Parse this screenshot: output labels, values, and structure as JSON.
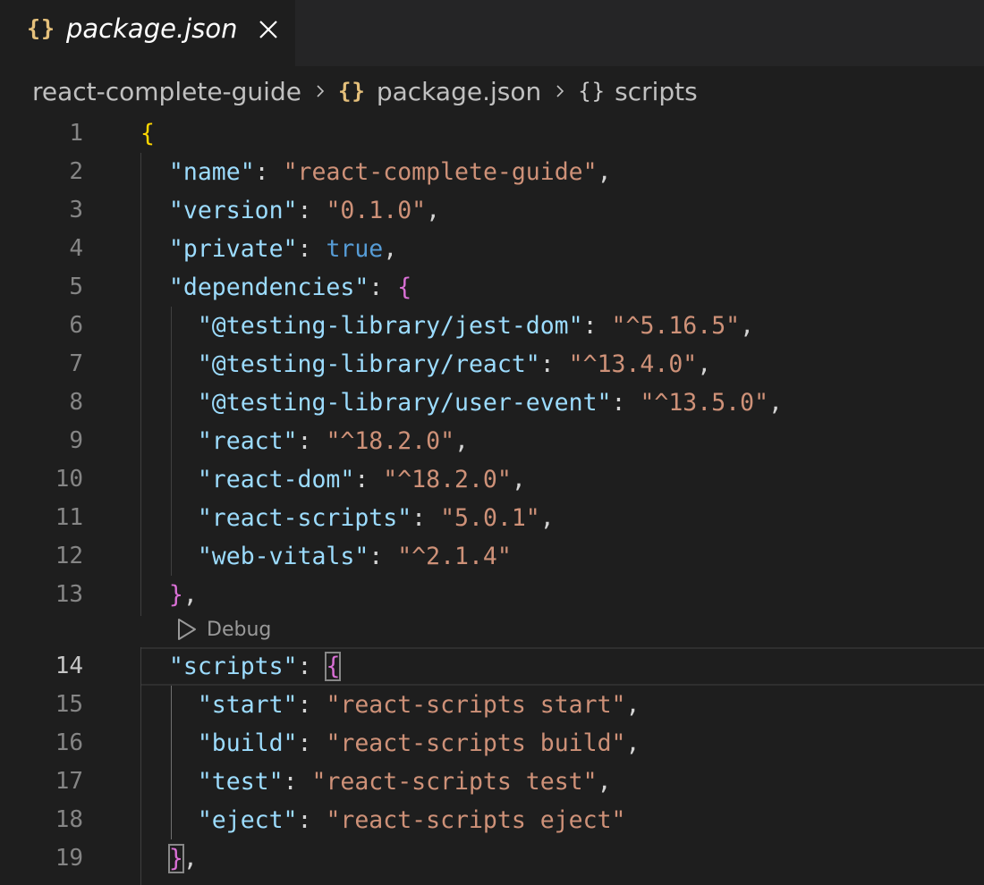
{
  "tab": {
    "icon": "json-braces-icon",
    "label": "package.json",
    "close_icon": "close-icon"
  },
  "breadcrumb": {
    "items": [
      {
        "label": "react-complete-guide"
      },
      {
        "icon": "json-braces-icon",
        "label": "package.json"
      },
      {
        "icon": "object-braces-icon",
        "label": "scripts"
      }
    ]
  },
  "codelens": {
    "icon": "play-outline-icon",
    "label": "Debug"
  },
  "editor": {
    "active_line": 14,
    "lines": [
      {
        "n": "1",
        "tokens": [
          [
            "b1",
            "{"
          ]
        ]
      },
      {
        "n": "2",
        "tokens": [
          [
            "i",
            "  "
          ],
          [
            "key",
            "\"name\""
          ],
          [
            "p",
            ": "
          ],
          [
            "str",
            "\"react-complete-guide\""
          ],
          [
            "p",
            ","
          ]
        ]
      },
      {
        "n": "3",
        "tokens": [
          [
            "i",
            "  "
          ],
          [
            "key",
            "\"version\""
          ],
          [
            "p",
            ": "
          ],
          [
            "str",
            "\"0.1.0\""
          ],
          [
            "p",
            ","
          ]
        ]
      },
      {
        "n": "4",
        "tokens": [
          [
            "i",
            "  "
          ],
          [
            "key",
            "\"private\""
          ],
          [
            "p",
            ": "
          ],
          [
            "kw",
            "true"
          ],
          [
            "p",
            ","
          ]
        ]
      },
      {
        "n": "5",
        "tokens": [
          [
            "i",
            "  "
          ],
          [
            "key",
            "\"dependencies\""
          ],
          [
            "p",
            ": "
          ],
          [
            "b2",
            "{"
          ]
        ]
      },
      {
        "n": "6",
        "tokens": [
          [
            "i",
            "    "
          ],
          [
            "key",
            "\"@testing-library/jest-dom\""
          ],
          [
            "p",
            ": "
          ],
          [
            "str",
            "\"^5.16.5\""
          ],
          [
            "p",
            ","
          ]
        ]
      },
      {
        "n": "7",
        "tokens": [
          [
            "i",
            "    "
          ],
          [
            "key",
            "\"@testing-library/react\""
          ],
          [
            "p",
            ": "
          ],
          [
            "str",
            "\"^13.4.0\""
          ],
          [
            "p",
            ","
          ]
        ]
      },
      {
        "n": "8",
        "tokens": [
          [
            "i",
            "    "
          ],
          [
            "key",
            "\"@testing-library/user-event\""
          ],
          [
            "p",
            ": "
          ],
          [
            "str",
            "\"^13.5.0\""
          ],
          [
            "p",
            ","
          ]
        ]
      },
      {
        "n": "9",
        "tokens": [
          [
            "i",
            "    "
          ],
          [
            "key",
            "\"react\""
          ],
          [
            "p",
            ": "
          ],
          [
            "str",
            "\"^18.2.0\""
          ],
          [
            "p",
            ","
          ]
        ]
      },
      {
        "n": "10",
        "tokens": [
          [
            "i",
            "    "
          ],
          [
            "key",
            "\"react-dom\""
          ],
          [
            "p",
            ": "
          ],
          [
            "str",
            "\"^18.2.0\""
          ],
          [
            "p",
            ","
          ]
        ]
      },
      {
        "n": "11",
        "tokens": [
          [
            "i",
            "    "
          ],
          [
            "key",
            "\"react-scripts\""
          ],
          [
            "p",
            ": "
          ],
          [
            "str",
            "\"5.0.1\""
          ],
          [
            "p",
            ","
          ]
        ]
      },
      {
        "n": "12",
        "tokens": [
          [
            "i",
            "    "
          ],
          [
            "key",
            "\"web-vitals\""
          ],
          [
            "p",
            ": "
          ],
          [
            "str",
            "\"^2.1.4\""
          ]
        ]
      },
      {
        "n": "13",
        "tokens": [
          [
            "i",
            "  "
          ],
          [
            "b2",
            "}"
          ],
          [
            "p",
            ","
          ]
        ]
      },
      {
        "n": "14",
        "tokens": [
          [
            "i",
            "  "
          ],
          [
            "key",
            "\"scripts\""
          ],
          [
            "p",
            ": "
          ],
          [
            "b2 bm",
            "{"
          ]
        ]
      },
      {
        "n": "15",
        "tokens": [
          [
            "i",
            "    "
          ],
          [
            "key",
            "\"start\""
          ],
          [
            "p",
            ": "
          ],
          [
            "str",
            "\"react-scripts start\""
          ],
          [
            "p",
            ","
          ]
        ]
      },
      {
        "n": "16",
        "tokens": [
          [
            "i",
            "    "
          ],
          [
            "key",
            "\"build\""
          ],
          [
            "p",
            ": "
          ],
          [
            "str",
            "\"react-scripts build\""
          ],
          [
            "p",
            ","
          ]
        ]
      },
      {
        "n": "17",
        "tokens": [
          [
            "i",
            "    "
          ],
          [
            "key",
            "\"test\""
          ],
          [
            "p",
            ": "
          ],
          [
            "str",
            "\"react-scripts test\""
          ],
          [
            "p",
            ","
          ]
        ]
      },
      {
        "n": "18",
        "tokens": [
          [
            "i",
            "    "
          ],
          [
            "key",
            "\"eject\""
          ],
          [
            "p",
            ": "
          ],
          [
            "str",
            "\"react-scripts eject\""
          ]
        ]
      },
      {
        "n": "19",
        "tokens": [
          [
            "i",
            "  "
          ],
          [
            "b2 bm",
            "}"
          ],
          [
            "p",
            ","
          ]
        ]
      }
    ]
  }
}
